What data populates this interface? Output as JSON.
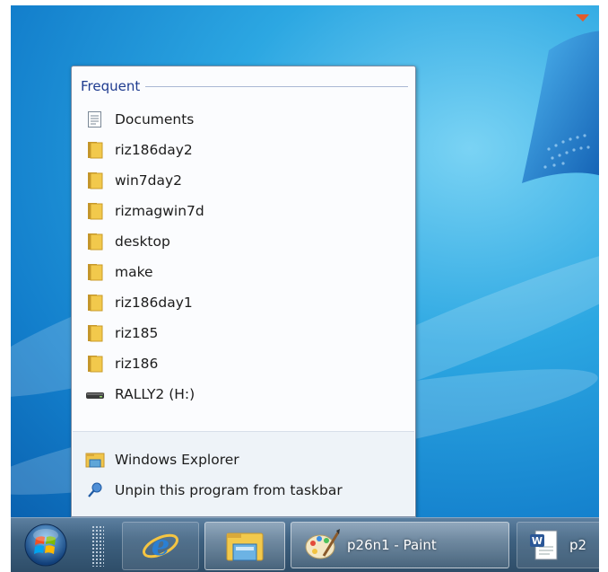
{
  "jump_list": {
    "section_title": "Frequent",
    "items": [
      {
        "label": "Documents",
        "icon": "document-icon"
      },
      {
        "label": "riz186day2",
        "icon": "folder-icon"
      },
      {
        "label": "win7day2",
        "icon": "folder-icon"
      },
      {
        "label": "rizmagwin7d",
        "icon": "folder-icon"
      },
      {
        "label": "desktop",
        "icon": "folder-icon"
      },
      {
        "label": "make",
        "icon": "folder-icon"
      },
      {
        "label": "riz186day1",
        "icon": "folder-icon"
      },
      {
        "label": "riz185",
        "icon": "folder-icon"
      },
      {
        "label": "riz186",
        "icon": "folder-icon"
      },
      {
        "label": "RALLY2 (H:)",
        "icon": "drive-icon"
      }
    ],
    "tasks": [
      {
        "label": "Windows Explorer",
        "icon": "explorer-icon"
      },
      {
        "label": "Unpin this program from taskbar",
        "icon": "unpin-icon"
      }
    ]
  },
  "taskbar": {
    "buttons": [
      {
        "label": "p26n1 - Paint",
        "icon": "paint-icon"
      },
      {
        "label": "p2",
        "icon": "word-icon"
      }
    ]
  },
  "colors": {
    "section_title": "#1e3b8f",
    "desktop_blue": "#1a8fd6",
    "folder_yellow": "#e8b936"
  }
}
